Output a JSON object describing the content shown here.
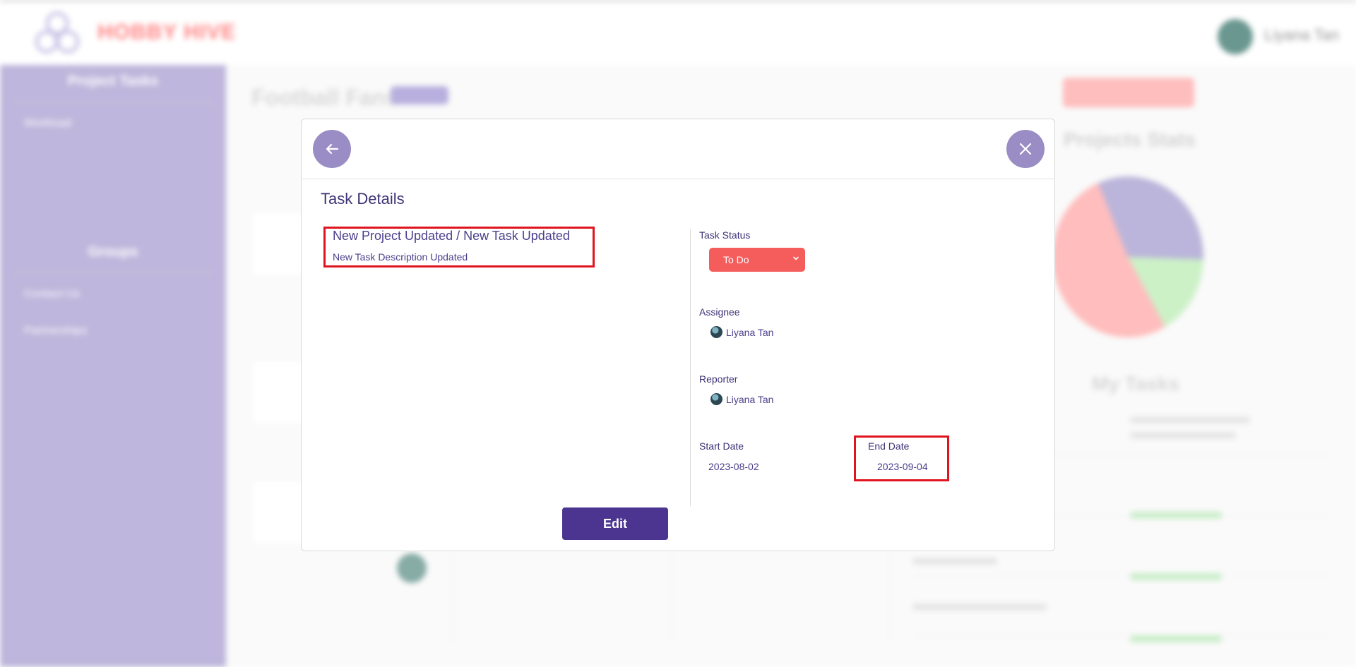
{
  "background": {
    "brand": "HOBBY HIVE",
    "user_name": "Liyana Tan",
    "sidebar": {
      "section1_title": "Project Tasks",
      "section1_items": [
        "Workload"
      ],
      "section2_title": "Groups",
      "section2_items": [
        "Contact Us",
        "Partnerships"
      ]
    },
    "page_title": "Football Fans",
    "stats_title": "Projects Stats",
    "tasks_title": "My Tasks"
  },
  "modal": {
    "title": "Task Details",
    "task": {
      "heading": "New Project Updated / New Task Updated",
      "description": "New Task Description Updated"
    },
    "status": {
      "label": "Task Status",
      "value": "To Do",
      "color": "#f55c5c"
    },
    "assignee": {
      "label": "Assignee",
      "name": "Liyana Tan"
    },
    "reporter": {
      "label": "Reporter",
      "name": "Liyana Tan"
    },
    "start_date": {
      "label": "Start Date",
      "value": "2023-08-02"
    },
    "end_date": {
      "label": "End Date",
      "value": "2023-09-04"
    },
    "edit_label": "Edit",
    "icons": {
      "back": "arrow-left-icon",
      "close": "close-icon"
    }
  },
  "colors": {
    "accent": "#4b3591",
    "header_button": "#9a8dc6",
    "highlight": "#e0141e",
    "sidebar": "#b9b0d9"
  }
}
